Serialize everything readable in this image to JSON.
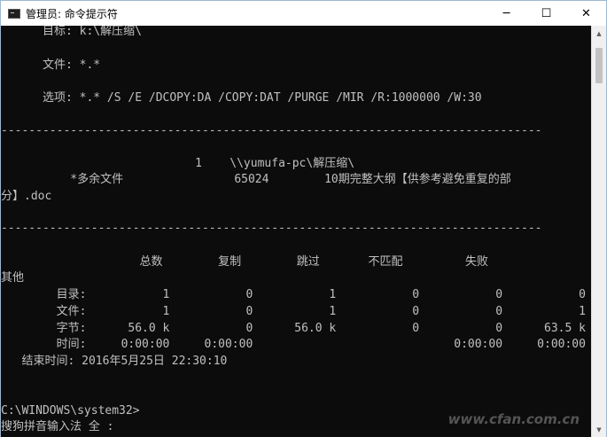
{
  "window": {
    "title": "管理员: 命令提示符",
    "controls": {
      "minimize": "─",
      "maximize": "☐",
      "close": "✕"
    },
    "icon": "cmd-icon"
  },
  "console": {
    "lines": [
      "      目标: k:\\解压缩\\",
      "",
      "      文件: *.*",
      "",
      "      选项: *.* /S /E /DCOPY:DA /COPY:DAT /PURGE /MIR /R:1000000 /W:30",
      "",
      "------------------------------------------------------------------------------",
      "",
      "                            1    \\\\yumufa-pc\\解压缩\\",
      "          *多余文件                65024        10期完整大纲【供参考避免重复的部",
      "分】.doc",
      "",
      "------------------------------------------------------------------------------",
      "",
      "                    总数        复制        跳过       不匹配         失败",
      "其他",
      "        目录:           1           0           1           0           0           0",
      "        文件:           1           0           1           0           0           1",
      "        字节:      56.0 k           0      56.0 k           0           0      63.5 k",
      "        时间:     0:00:00     0:00:00                             0:00:00     0:00:00",
      "   结束时间: 2016年5月25日 22:30:10",
      "",
      "",
      "C:\\WINDOWS\\system32>",
      "搜狗拼音输入法 全 :"
    ]
  },
  "watermark": "www.cfan.com.cn",
  "colors": {
    "console_bg": "#0c0c0c",
    "console_text": "#c0c0c0",
    "titlebar_bg": "#ffffff"
  }
}
